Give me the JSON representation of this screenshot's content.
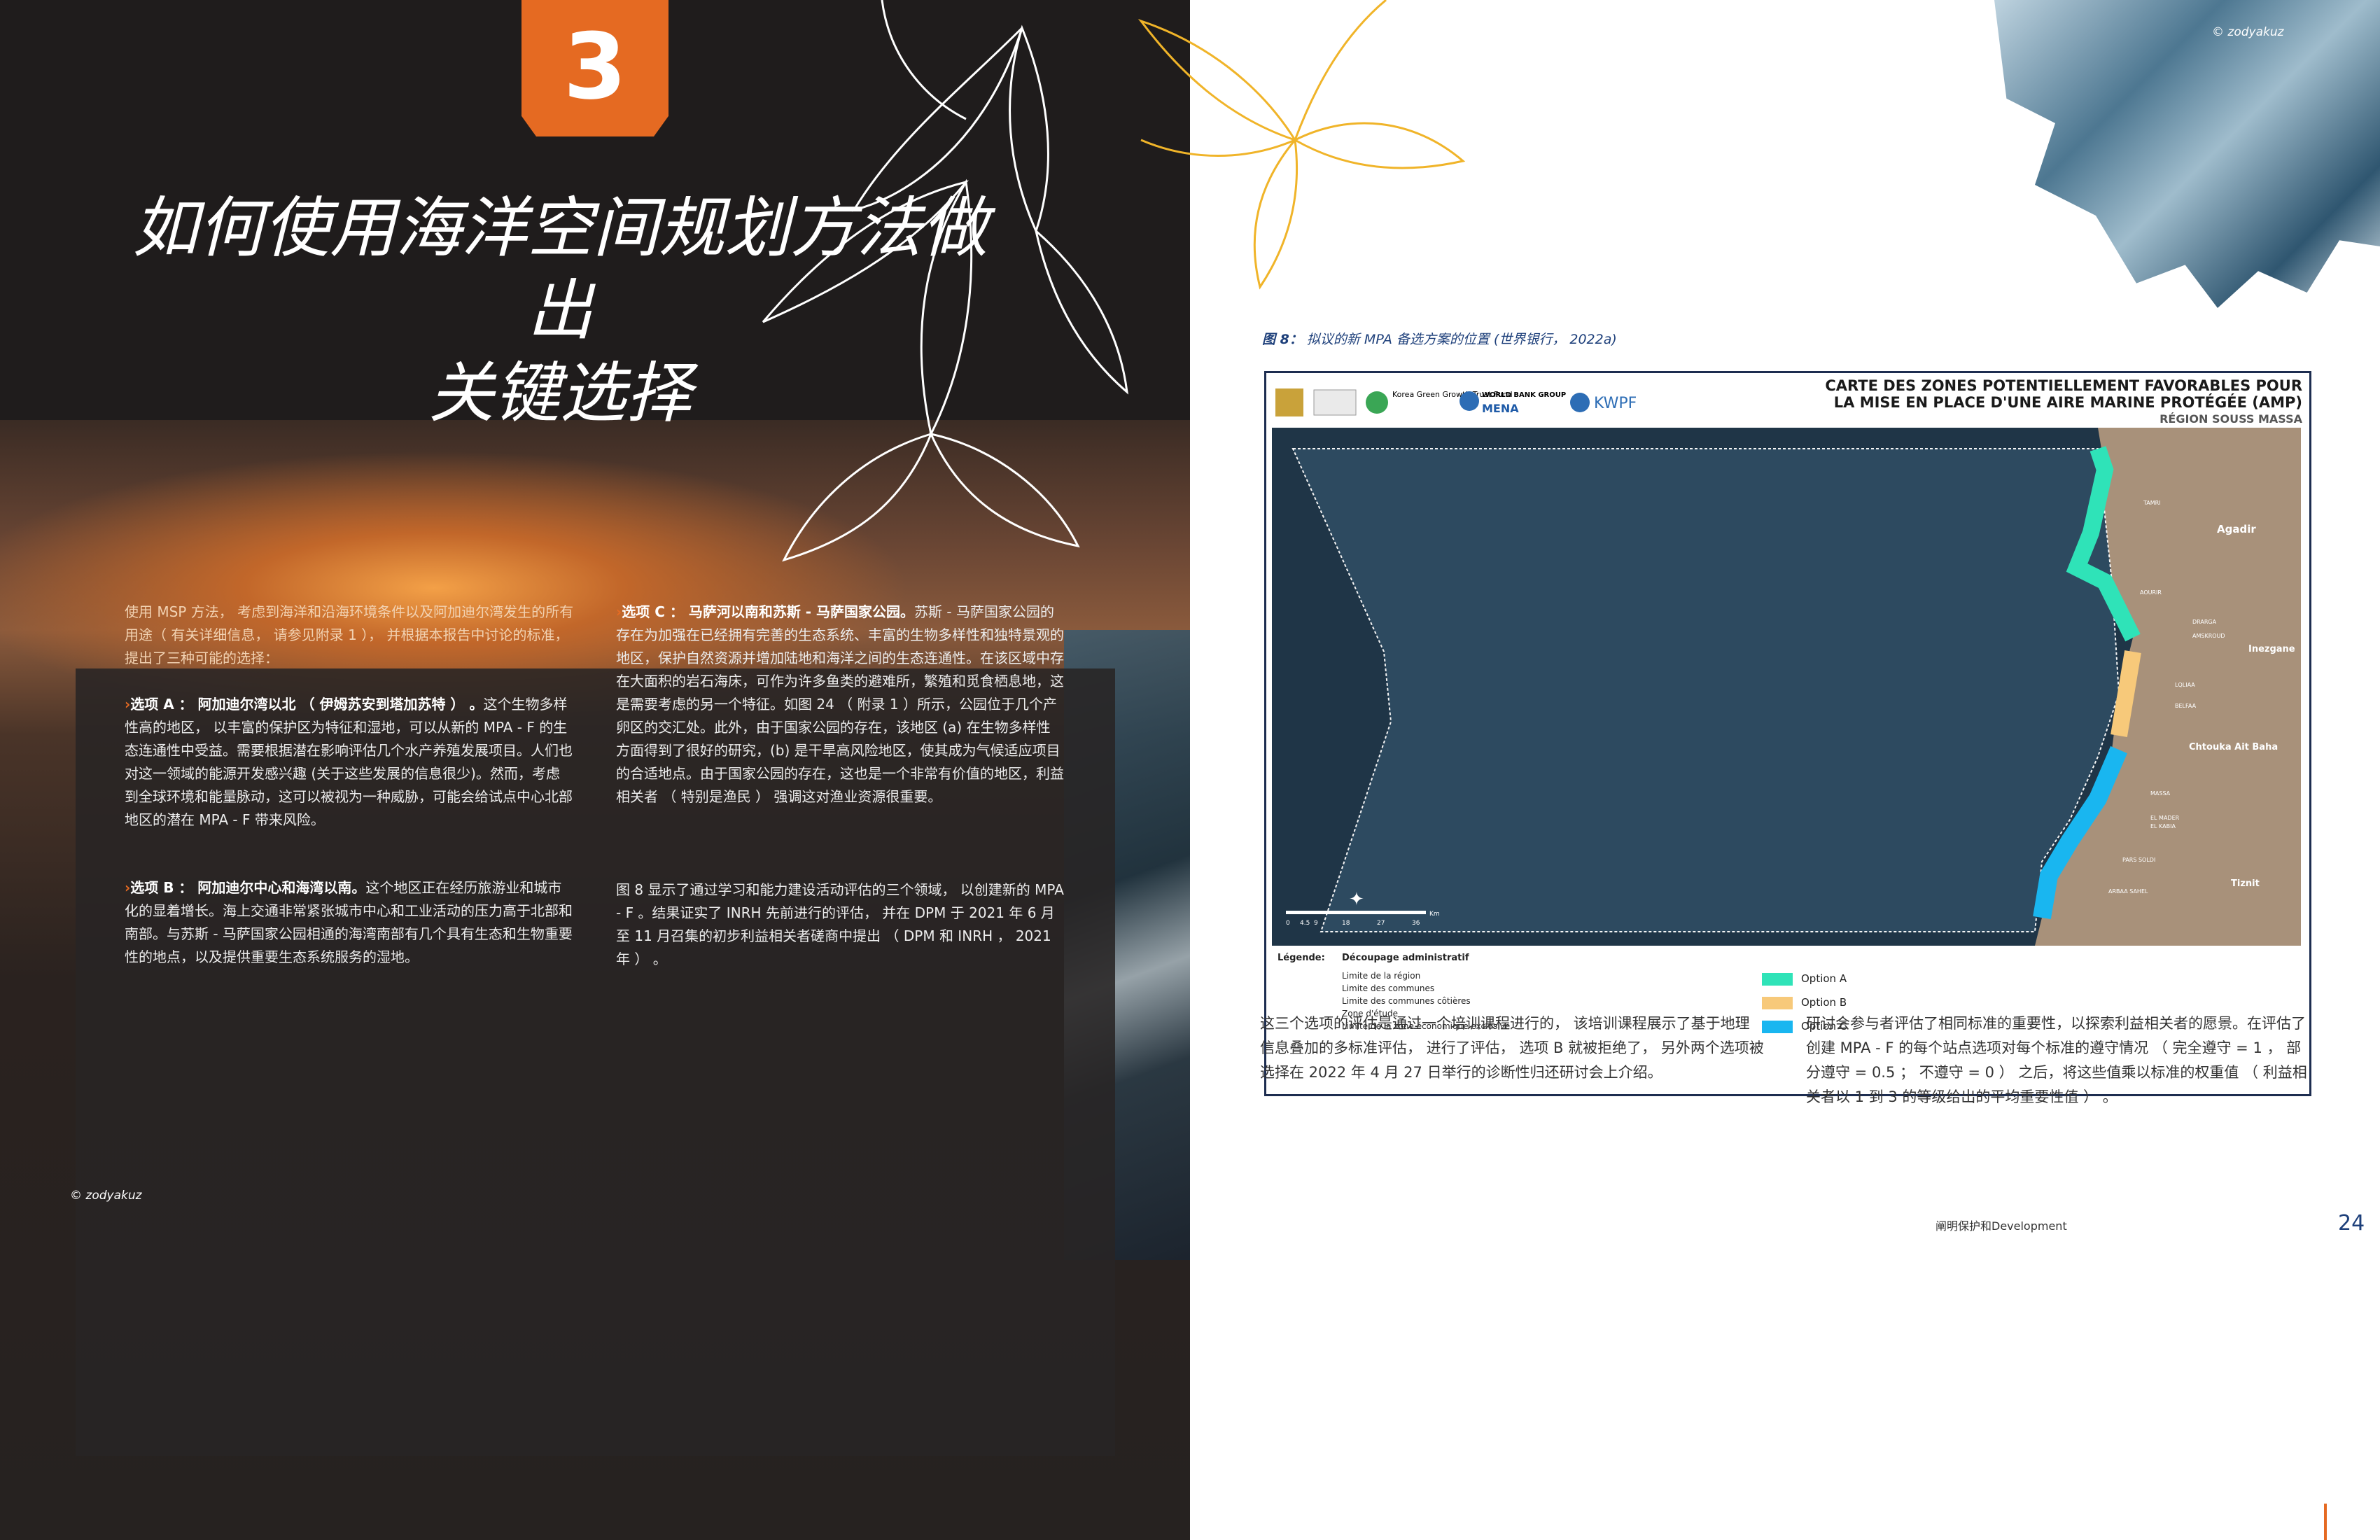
{
  "left_page": {
    "chapter_number": "3",
    "title_line1": "如何使用海洋空间规划方法做出",
    "title_line2": "关键选择",
    "intro": "使用 MSP 方法， 考虑到海洋和沿海环境条件以及阿加迪尔湾发生的所有用途（ 有关详细信息， 请参见附录 1 ）， 并根据本报告中讨论的标准， 提出了三种可能的选择：",
    "option_a_title": "选项 A ： 阿加迪尔湾以北 （ 伊姆苏安到塔加苏特 ） 。",
    "option_a_text": "这个生物多样性高的地区， 以丰富的保护区为特征和湿地，可以从新的 MPA - F 的生态连通性中受益。需要根据潜在影响评估几个水产养殖发展项目。人们也对这一领域的能源开发感兴趣 (关于这些发展的信息很少)。然而，考虑到全球环境和能量脉动，这可以被视为一种威胁，可能会给试点中心北部地区的潜在 MPA - F 带来风险。",
    "option_b_title": "选项 B ： 阿加迪尔中心和海湾以南。",
    "option_b_text": "这个地区正在经历旅游业和城市化的显着增长。海上交通非常紧张城市中心和工业活动的压力高于北部和南部。与苏斯 - 马萨国家公园相通的海湾南部有几个具有生态和生物重要性的地点，以及提供重要生态系统服务的湿地。",
    "option_c_title": "选项 C ： 马萨河以南和苏斯 - 马萨国家公园。",
    "option_c_text": "苏斯 - 马萨国家公园的存在为加强在已经拥有完善的生态系统、丰富的生物多样性和独特景观的地区，保护自然资源并增加陆地和海洋之间的生态连通性。在该区域中存在大面积的岩石海床，可作为许多鱼类的避难所，繁殖和觅食栖息地，这是需要考虑的另一个特征。如图 24 （ 附录 1 ）所示，公园位于几个产卵区的交汇处。此外，由于国家公园的存在，该地区 (a) 在生物多样性方面得到了很好的研究，(b) 是干旱高风险地区，使其成为气候适应项目的合适地点。由于国家公园的存在，这也是一个非常有价值的地区，利益相关者 （ 特别是渔民 ） 强调这对渔业资源很重要。",
    "fig8_text": "图 8 显示了通过学习和能力建设活动评估的三个领域， 以创建新的 MPA - F 。结果证实了 INRH 先前进行的评估， 并在 DPM 于 2021 年 6 月至 11 月召集的初步利益相关者磋商中提出 （ DPM 和 INRH ， 2021 年 ） 。",
    "photo_credit": "© zodyakuz"
  },
  "right_page": {
    "photo_credit": "© zodyakuz",
    "figure_caption_label": "图 8：",
    "figure_caption": "拟议的新 MPA 备选方案的位置 (世界银行， 2022a)",
    "map": {
      "title_line1": "CARTE DES ZONES POTENTIELLEMENT FAVORABLES POUR",
      "title_line2": "LA MISE EN PLACE D'UNE AIRE MARINE PROTÉGÉE (AMP)",
      "title_line3": "RÉGION SOUSS MASSA",
      "logos": [
        "Korea Green Growth Trust Fund",
        "WORLD BANK GROUP",
        "MENA",
        "KWPF"
      ],
      "places": [
        "Agadir",
        "Inezgane",
        "Chtouka Ait Baha",
        "Tiznit",
        "MASSA",
        "EL MADER",
        "EL KABIA",
        "PARS SOLDI",
        "ARBAA SAHEL",
        "DRARGA",
        "AMSKROUD",
        "LQLIAA",
        "BELFAA",
        "TAMRI",
        "AOURIR"
      ],
      "legend_label": "Légende:",
      "legend_admin": "Découpage administratif",
      "legend_items": [
        "Limite de la région",
        "Limite des communes",
        "Limite des communes côtières",
        "Zone d'étude",
        "Limite de la zone économique exclusive"
      ],
      "options": [
        {
          "label": "Option A",
          "color": "#2fe3b8"
        },
        {
          "label": "Option B",
          "color": "#f7c97a"
        },
        {
          "label": "Option C",
          "color": "#19b6f0"
        }
      ],
      "scale_label": "Km",
      "scale_ticks": [
        "0",
        "4.5",
        "9",
        "18",
        "27",
        "36"
      ]
    },
    "body_left": "这三个选项的评估是通过一个培训课程进行的， 该培训课程展示了基于地理信息叠加的多标准评估， 进行了评估， 选项 B 就被拒绝了， 另外两个选项被选择在 2022 年 4 月 27 日举行的诊断性归还研讨会上介绍。",
    "body_right": "研讨会参与者评估了相同标准的重要性，以探索利益相关者的愿景。在评估了创建 MPA - F 的每个站点选项对每个标准的遵守情况 （ 完全遵守 = 1 ， 部分遵守 = 0.5 ； 不遵守 = 0 ） 之后，将这些值乘以标准的权重值 （ 利益相关者以 1 到 3 的等级给出的平均重要性值 ） 。",
    "footer": "阐明保护和Development",
    "page_number": "24"
  }
}
